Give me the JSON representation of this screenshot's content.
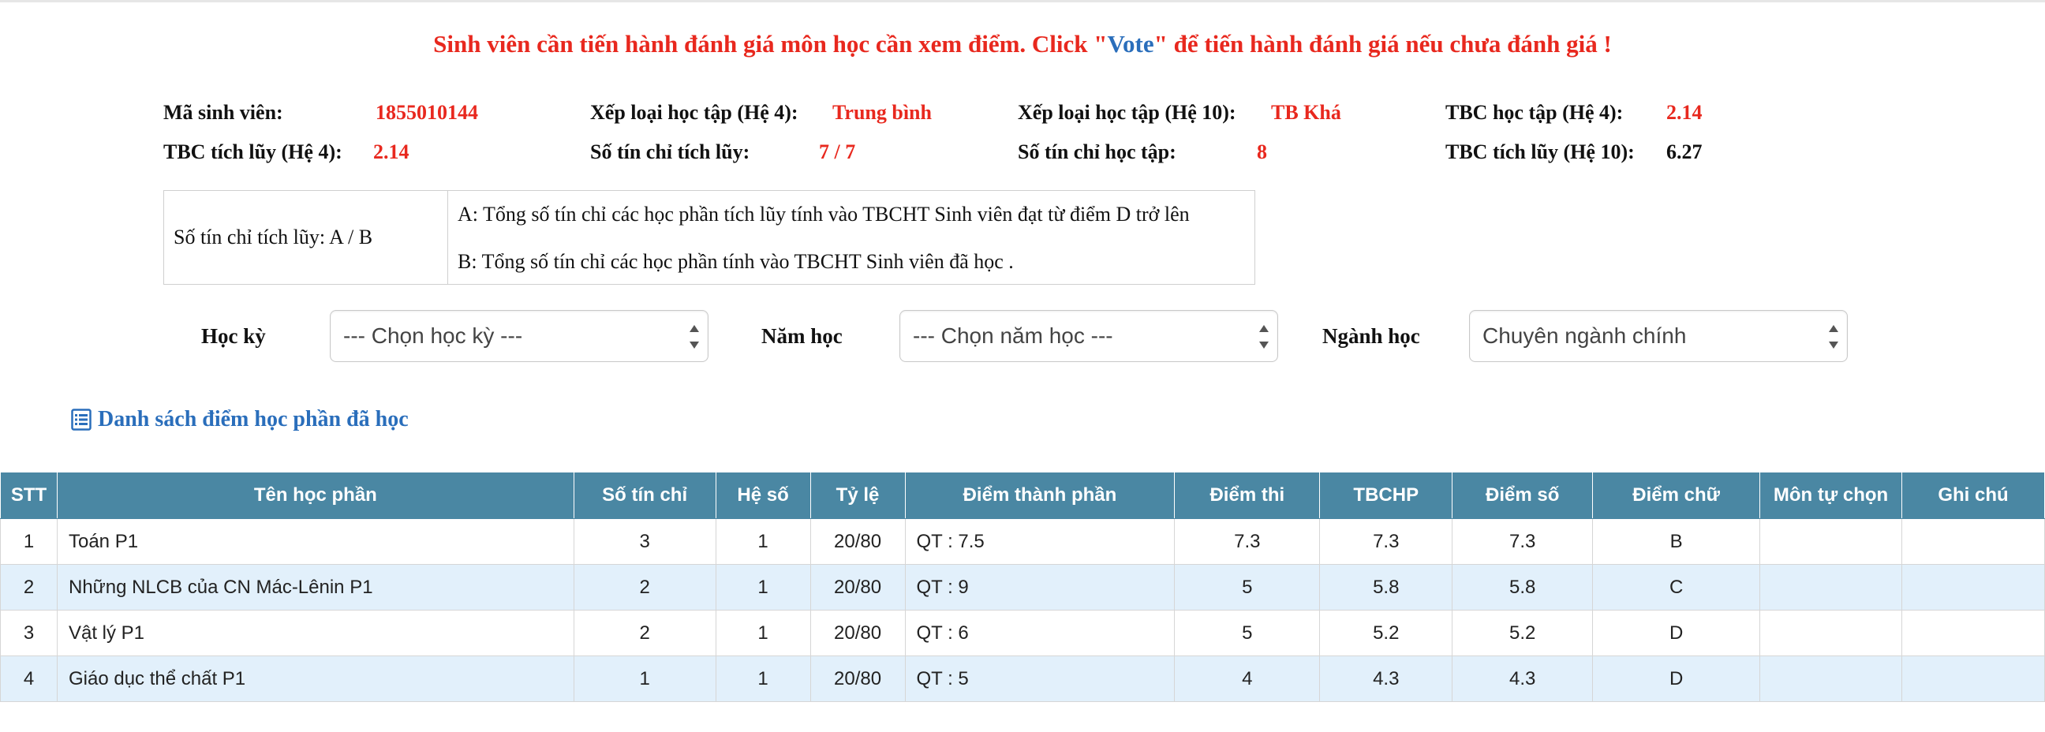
{
  "notice": {
    "before": "Sinh viên cần tiến hành đánh giá môn học cần xem điểm. Click \"",
    "vote": "Vote",
    "after": "\" để tiến hành đánh giá nếu chưa đánh giá !"
  },
  "info": {
    "row1": [
      {
        "label": "Mã sinh viên:",
        "value": "1855010144"
      },
      {
        "label": "Xếp loại học tập (Hệ 4):",
        "value": "Trung bình"
      },
      {
        "label": "Xếp loại học tập (Hệ 10):",
        "value": "TB Khá"
      },
      {
        "label": "TBC học tập (Hệ 4):",
        "value": "2.14"
      }
    ],
    "row2": [
      {
        "label": "TBC tích lũy (Hệ 4):",
        "value": "2.14"
      },
      {
        "label": "Số tín chỉ tích lũy:",
        "value": "7 / 7"
      },
      {
        "label": "Số tín chỉ học tập:",
        "value": "8"
      },
      {
        "label": "TBC tích lũy (Hệ 10):",
        "value": "6.27"
      }
    ]
  },
  "legend": {
    "left": "Số tín chỉ tích lũy: A / B",
    "a": "A: Tổng số tín chỉ các học phần tích lũy tính vào TBCHT Sinh viên đạt từ điểm D trở lên",
    "b": "B: Tổng số tín chỉ các học phần tính vào TBCHT Sinh viên đã học ."
  },
  "filters": {
    "semester_label": "Học kỳ",
    "semester_value": "--- Chọn học kỳ ---",
    "year_label": "Năm học",
    "year_value": "--- Chọn năm học ---",
    "major_label": "Ngành học",
    "major_value": "Chuyên ngành chính"
  },
  "list_title": "Danh sách điểm học phần đã học",
  "table": {
    "headers": [
      "STT",
      "Tên học phần",
      "Số tín chỉ",
      "Hệ số",
      "Tỷ lệ",
      "Điểm thành phần",
      "Điểm thi",
      "TBCHP",
      "Điểm số",
      "Điểm chữ",
      "Môn tự chọn",
      "Ghi chú"
    ],
    "rows": [
      [
        "1",
        "Toán P1",
        "3",
        "1",
        "20/80",
        "QT : 7.5",
        "7.3",
        "7.3",
        "7.3",
        "B",
        "",
        ""
      ],
      [
        "2",
        "Những NLCB của CN Mác-Lênin P1",
        "2",
        "1",
        "20/80",
        "QT : 9",
        "5",
        "5.8",
        "5.8",
        "C",
        "",
        ""
      ],
      [
        "3",
        "Vật lý P1",
        "2",
        "1",
        "20/80",
        "QT : 6",
        "5",
        "5.2",
        "5.2",
        "D",
        "",
        ""
      ],
      [
        "4",
        "Giáo dục thể chất P1",
        "1",
        "1",
        "20/80",
        "QT : 5",
        "4",
        "4.3",
        "4.3",
        "D",
        "",
        ""
      ]
    ]
  },
  "colors": {
    "accent_red": "#e8281e",
    "link_blue": "#2a6ebb",
    "header_teal": "#4a87a3",
    "row_alt": "#e2f0fb"
  }
}
